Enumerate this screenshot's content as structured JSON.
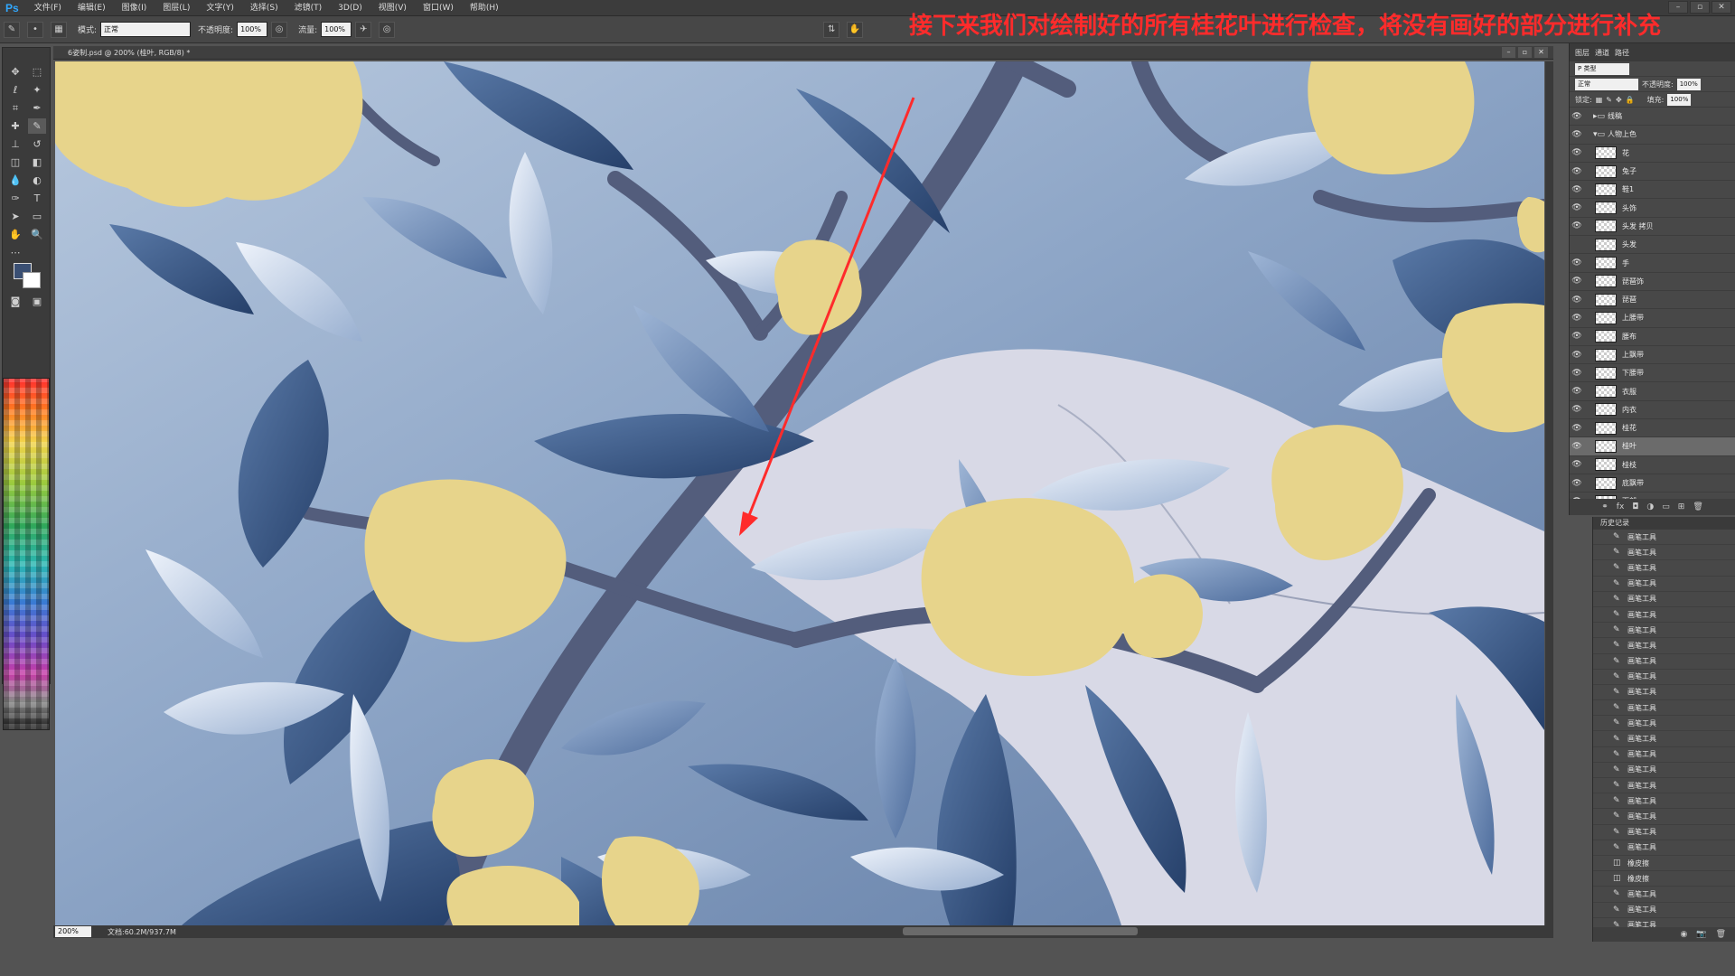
{
  "app": {
    "logo": "Ps"
  },
  "menu": [
    "文件(F)",
    "编辑(E)",
    "图像(I)",
    "图层(L)",
    "文字(Y)",
    "选择(S)",
    "滤镜(T)",
    "3D(D)",
    "视图(V)",
    "窗口(W)",
    "帮助(H)"
  ],
  "options": {
    "mode_label": "模式:",
    "mode_value": "正常",
    "opacity_label": "不透明度:",
    "opacity_value": "100%",
    "flow_label": "流量:",
    "flow_value": "100%"
  },
  "caption": "接下来我们对绘制好的所有桂花叶进行检查，将没有画好的部分进行补充",
  "document": {
    "tab_title": "6姿制.psd @ 200% (桂叶, RGB/8) *"
  },
  "status": {
    "zoom": "200%",
    "doc_info": "文档:60.2M/937.7M"
  },
  "layers_panel": {
    "tabs": [
      "图层",
      "通道",
      "路径"
    ],
    "kind_label": "P 类型",
    "blend_mode": "正常",
    "opacity_label": "不透明度:",
    "opacity": "100%",
    "lock_label": "锁定:",
    "fill_label": "填充:",
    "fill": "100%",
    "groups": [
      {
        "name": "线稿"
      },
      {
        "name": "人物上色"
      }
    ],
    "layers": [
      {
        "name": "花",
        "visible": true
      },
      {
        "name": "兔子",
        "visible": true
      },
      {
        "name": "鞋1",
        "visible": true
      },
      {
        "name": "头饰",
        "visible": true
      },
      {
        "name": "头发 拷贝",
        "visible": true
      },
      {
        "name": "头发",
        "visible": false
      },
      {
        "name": "手",
        "visible": true
      },
      {
        "name": "琵琶饰",
        "visible": true
      },
      {
        "name": "琵琶",
        "visible": true
      },
      {
        "name": "上腰带",
        "visible": true
      },
      {
        "name": "腰布",
        "visible": true
      },
      {
        "name": "上飘带",
        "visible": true
      },
      {
        "name": "下腰带",
        "visible": true
      },
      {
        "name": "衣服",
        "visible": true
      },
      {
        "name": "内衣",
        "visible": true
      },
      {
        "name": "桂花",
        "visible": true
      },
      {
        "name": "桂叶",
        "visible": true,
        "active": true
      },
      {
        "name": "桂枝",
        "visible": true
      },
      {
        "name": "底飘带",
        "visible": true
      },
      {
        "name": "面部",
        "visible": true
      }
    ]
  },
  "history_panel": {
    "title": "历史记录",
    "items": [
      "画笔工具",
      "画笔工具",
      "画笔工具",
      "画笔工具",
      "画笔工具",
      "画笔工具",
      "画笔工具",
      "画笔工具",
      "画笔工具",
      "画笔工具",
      "画笔工具",
      "画笔工具",
      "画笔工具",
      "画笔工具",
      "画笔工具",
      "画笔工具",
      "画笔工具",
      "画笔工具",
      "画笔工具",
      "画笔工具",
      "画笔工具",
      "橡皮擦",
      "橡皮擦",
      "画笔工具",
      "画笔工具",
      "画笔工具",
      "画笔工具",
      "画笔工具"
    ]
  },
  "colors": {
    "foreground": "#3a4f73",
    "background": "#ffffff",
    "leaf_dark": "#34507e",
    "leaf_light": "#c9d6ea",
    "flower": "#e7d48b",
    "branch": "#535d7c",
    "annotation": "#ff2b2b"
  }
}
